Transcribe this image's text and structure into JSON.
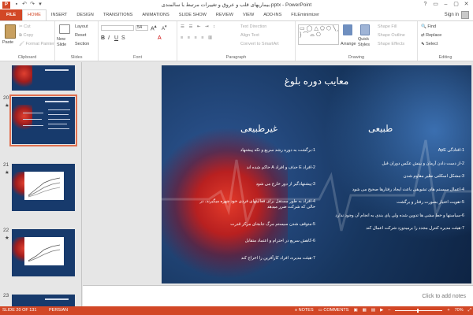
{
  "titlebar": {
    "title": "بیماریهای قلب و عروق و تغییرات مرتبط با سالمندی.pptx - PowerPoint",
    "app_icon": "P",
    "qat_icons": [
      "save-icon",
      "undo-icon",
      "redo-icon",
      "customize-icon"
    ],
    "window_controls": [
      "?",
      "▭",
      "–",
      "▢",
      "✕"
    ]
  },
  "tabs": [
    "FILE",
    "HOME",
    "INSERT",
    "DESIGN",
    "TRANSITIONS",
    "ANIMATIONS",
    "SLIDE SHOW",
    "REVIEW",
    "VIEW",
    "ADD-INS",
    "FILEminimizer"
  ],
  "active_tab": "HOME",
  "signin": "Sign in",
  "ribbon": {
    "clipboard": {
      "paste": "Paste",
      "cut": "Cut",
      "copy": "Copy",
      "format_painter": "Format Painter",
      "name": "Clipboard"
    },
    "slides": {
      "new_slide": "New Slide",
      "layout": "Layout",
      "reset": "Reset",
      "section": "Section",
      "name": "Slides"
    },
    "font": {
      "size": "54",
      "name": "Font"
    },
    "paragraph": {
      "text_direction": "Text Direction",
      "align_text": "Align Text",
      "convert_smartart": "Convert to SmartArt",
      "name": "Paragraph"
    },
    "drawing": {
      "arrange": "Arrange",
      "quick_styles": "Quick Styles",
      "shape_fill": "Shape Fill",
      "shape_outline": "Shape Outline",
      "shape_effects": "Shape Effects",
      "name": "Drawing"
    },
    "editing": {
      "find": "Find",
      "replace": "Replace",
      "select": "Select",
      "name": "Editing"
    }
  },
  "thumbnails": [
    {
      "num": "20",
      "star": "★",
      "selected": true
    },
    {
      "num": "21",
      "star": "★",
      "selected": false
    },
    {
      "num": "22",
      "star": "★",
      "selected": false
    },
    {
      "num": "23",
      "star": "",
      "selected": false
    }
  ],
  "slide": {
    "title": "معایب دوره بلوغ",
    "right_col": {
      "heading": "طبیعی",
      "items": [
        "1-افتادگی ApE",
        "2-از دست دادن آرمان و بینش عکس دوران قبل",
        "3-مشکل اسکلتی نظیر مقاوم شدن",
        "4-اعمال سیستم های تشویقی باعث ایجاد رفتارها صحیح می شود",
        "5-تقویت اختیار بصورت رفتار و برگشت",
        "6-سیاستها و خط مشی ها تدوین شده ولی پای بندی به انجام آن وجود ندارد",
        "7-هیئت مدیره کنترل مجدد را برمیدوزد شرکت اعمال کند"
      ]
    },
    "left_col": {
      "heading": "غیرطبیعی",
      "items": [
        "1-برگشت به دوره رشد سریع و تکه پیشنهاد",
        "2-افراد E حذف و افراد A حاکم شده اند",
        "3-پیشنهادگیر از دور خارج می شود",
        "4-افراد به طور مستقل برای فعالیتهای فردی خود چهره میگیرند، در حالی که شرکت ضرر میدهد",
        "5-متوقف شدن سیستم مرگ جابجای مرکز قدرت",
        "6-کاهش سریع در احترام و اعتماد متقابل",
        "7-هیئت مدیره، افراد کارآفرین را اخراج کند"
      ]
    }
  },
  "notes_placeholder": "Click to add notes",
  "status": {
    "slide_info": "SLIDE 20 OF 131",
    "language": "PERSIAN",
    "notes": "NOTES",
    "comments": "COMMENTS",
    "zoom": "70%"
  },
  "colors": {
    "accent": "#d24726",
    "slide_bg": "#17365f"
  }
}
